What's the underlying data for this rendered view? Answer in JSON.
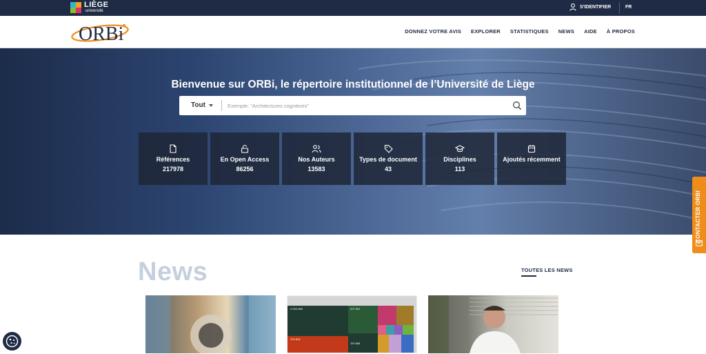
{
  "topbar": {
    "university_name": "LIÈGE",
    "university_sub": "université",
    "login_label": "S'IDENTIFIER",
    "lang_label": "FR"
  },
  "nav": {
    "logo_text": "ORBi",
    "links": [
      "DONNEZ VOTRE AVIS",
      "EXPLORER",
      "STATISTIQUES",
      "NEWS",
      "AIDE",
      "À PROPOS"
    ]
  },
  "hero": {
    "title": "Bienvenue sur ORBi, le répertoire institutionnel de l’Université de Liège",
    "search": {
      "scope": "Tout",
      "placeholder": "Exemple: \"Architectures cognitives\""
    },
    "stats": [
      {
        "icon": "document-icon",
        "label": "Références",
        "value": "217978"
      },
      {
        "icon": "lock-icon",
        "label": "En Open Access",
        "value": "86256"
      },
      {
        "icon": "users-icon",
        "label": "Nos Auteurs",
        "value": "13583"
      },
      {
        "icon": "tag-icon",
        "label": "Types de document",
        "value": "43"
      },
      {
        "icon": "graduation-cap-icon",
        "label": "Disciplines",
        "value": "113"
      },
      {
        "icon": "calendar-icon",
        "label": "Ajoutés récemment",
        "value": ""
      }
    ]
  },
  "contact": {
    "label": "CONTACTER ORBI"
  },
  "news": {
    "title": "News",
    "all_label": "TOUTES LES NEWS",
    "cards": [
      {
        "type": "collage"
      },
      {
        "type": "treemap",
        "labels": [
          "2 534 989",
          "471 501",
          "476 819",
          "119 868"
        ]
      },
      {
        "type": "video"
      }
    ]
  },
  "colors": {
    "navy": "#1f2a44",
    "orange_accent": "#f08c19",
    "news_title": "#c5d0dd"
  }
}
